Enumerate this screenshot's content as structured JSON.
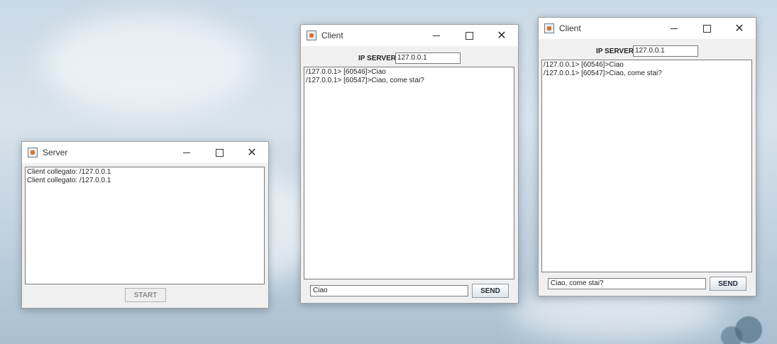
{
  "server": {
    "title": "Server",
    "log": [
      "Client collegato: /127.0.0.1",
      "Client collegato: /127.0.0.1"
    ],
    "start_label": "START"
  },
  "client1": {
    "title": "Client",
    "ip_label": "IP SERVER",
    "ip_value": "127.0.0.1",
    "log": [
      "/127.0.0.1> [60546]>Ciao",
      "/127.0.0.1> [60547]>Ciao, come stai?"
    ],
    "message_value": "Ciao",
    "send_label": "SEND"
  },
  "client2": {
    "title": "Client",
    "ip_label": "IP SERVER",
    "ip_value": "127.0.0.1",
    "log": [
      "/127.0.0.1> [60546]>Ciao",
      "/127.0.0.1> [60547]>Ciao, come stai?"
    ],
    "message_value": "Ciao, come stai?",
    "send_label": "SEND"
  },
  "window_controls": {
    "minimize": "minimize-icon",
    "maximize": "maximize-icon",
    "close": "close-icon"
  },
  "colors": {
    "window_bg": "#f0f0f0",
    "titlebar_bg": "#ffffff",
    "text": "#222222"
  }
}
